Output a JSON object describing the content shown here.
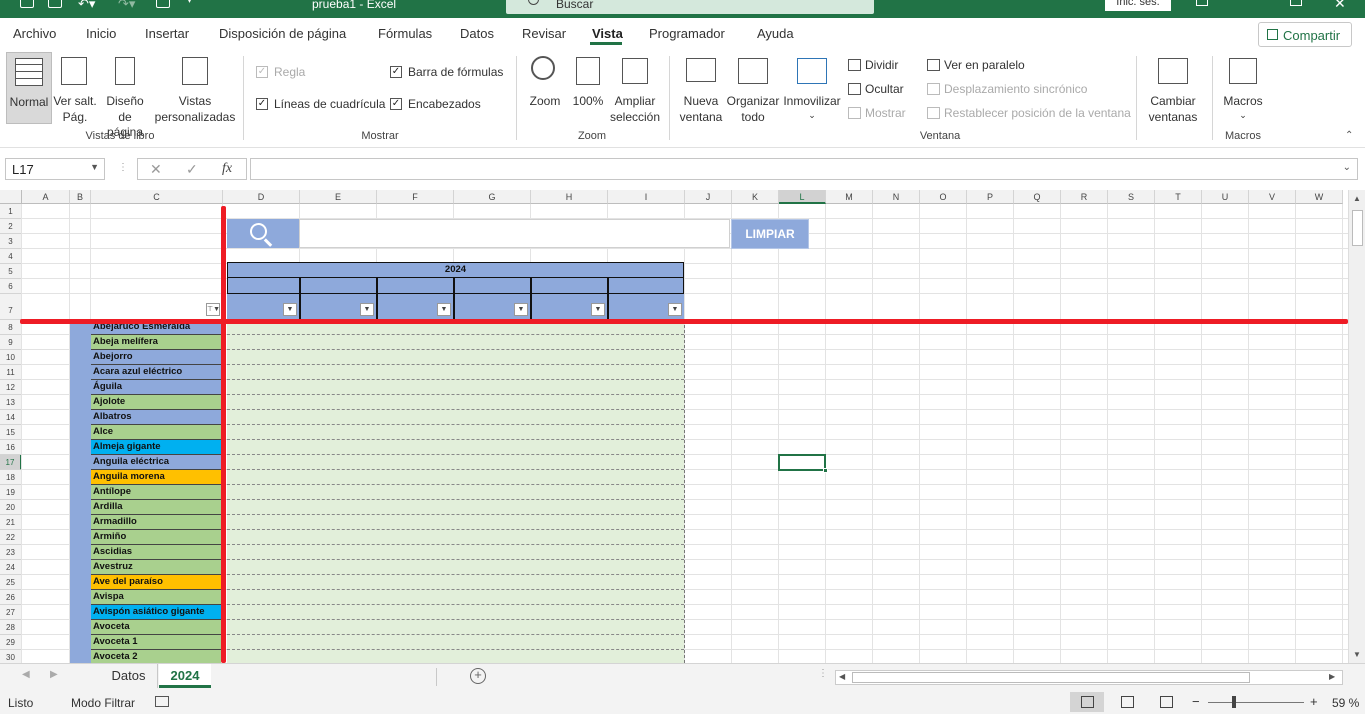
{
  "titlebar": {
    "doc_title": "prueba1  -  Excel",
    "search_placeholder": "Buscar",
    "signin": "Inic. ses."
  },
  "menu": {
    "tabs": [
      "Archivo",
      "Inicio",
      "Insertar",
      "Disposición de página",
      "Fórmulas",
      "Datos",
      "Revisar",
      "Vista",
      "Programador",
      "Ayuda"
    ],
    "active_tab": "Vista",
    "share": "Compartir"
  },
  "ribbon": {
    "vistas": {
      "normal": "Normal",
      "saltos_1": "Ver salt.",
      "saltos_2": "Pág.",
      "diseno_1": "Diseño",
      "diseno_2": "de página",
      "pers_1": "Vistas",
      "pers_2": "personalizadas",
      "group": "Vistas de libro"
    },
    "mostrar": {
      "regla": "Regla",
      "barra": "Barra de fórmulas",
      "lineas": "Líneas de cuadrícula",
      "encabezados": "Encabezados",
      "group": "Mostrar"
    },
    "zoom": {
      "zoom": "Zoom",
      "cien": "100%",
      "ampliar_1": "Ampliar",
      "ampliar_2": "selección",
      "group": "Zoom"
    },
    "ventana": {
      "nueva_1": "Nueva",
      "nueva_2": "ventana",
      "organizar_1": "Organizar",
      "organizar_2": "todo",
      "inmovilizar": "Inmovilizar",
      "dividir": "Dividir",
      "ocultar": "Ocultar",
      "mostrar": "Mostrar",
      "paralelo": "Ver en paralelo",
      "sincronico": "Desplazamiento sincrónico",
      "restablecer": "Restablecer posición de la ventana",
      "cambiar_1": "Cambiar",
      "cambiar_2": "ventanas",
      "group": "Ventana"
    },
    "macros": {
      "macros": "Macros",
      "group": "Macros"
    }
  },
  "formula_bar": {
    "name_box": "L17",
    "fx": "fx",
    "value": ""
  },
  "grid": {
    "columns": [
      "A",
      "B",
      "C",
      "D",
      "E",
      "F",
      "G",
      "H",
      "I",
      "J",
      "K",
      "L",
      "M",
      "N",
      "O",
      "P",
      "Q",
      "R",
      "S",
      "T",
      "U",
      "V",
      "W"
    ],
    "rows": [
      "1",
      "2",
      "3",
      "4",
      "5",
      "6",
      "7",
      "8",
      "9",
      "10",
      "11",
      "12",
      "13",
      "14",
      "15",
      "16",
      "17",
      "18",
      "19",
      "20",
      "21",
      "22",
      "23",
      "24",
      "25",
      "26",
      "27",
      "28",
      "29",
      "30"
    ],
    "year_header": "2024",
    "clear_button": "LIMPIAR",
    "animals": [
      {
        "name": "Abejaruco Esmeralda",
        "color": "#8ea9db"
      },
      {
        "name": "Abeja melífera",
        "color": "#a9d08e"
      },
      {
        "name": "Abejorro",
        "color": "#8ea9db"
      },
      {
        "name": "Acara azul eléctrico",
        "color": "#8ea9db"
      },
      {
        "name": "Águila",
        "color": "#8ea9db"
      },
      {
        "name": "Ajolote",
        "color": "#a9d08e"
      },
      {
        "name": "Albatros",
        "color": "#8ea9db"
      },
      {
        "name": "Alce",
        "color": "#a9d08e"
      },
      {
        "name": "Almeja gigante",
        "color": "#00b0f0"
      },
      {
        "name": "Anguila eléctrica",
        "color": "#8ea9db"
      },
      {
        "name": "Anguila morena",
        "color": "#ffc000"
      },
      {
        "name": "Antílope",
        "color": "#a9d08e"
      },
      {
        "name": "Ardilla",
        "color": "#a9d08e"
      },
      {
        "name": "Armadillo",
        "color": "#a9d08e"
      },
      {
        "name": "Armiño",
        "color": "#a9d08e"
      },
      {
        "name": "Ascidias",
        "color": "#a9d08e"
      },
      {
        "name": "Avestruz",
        "color": "#a9d08e"
      },
      {
        "name": "Ave del paraíso",
        "color": "#ffc000"
      },
      {
        "name": "Avispa",
        "color": "#a9d08e"
      },
      {
        "name": "Avispón asiático gigante",
        "color": "#00b0f0"
      },
      {
        "name": "Avoceta",
        "color": "#a9d08e"
      },
      {
        "name": "Avoceta 1",
        "color": "#a9d08e"
      },
      {
        "name": "Avoceta 2",
        "color": "#a9d08e"
      }
    ]
  },
  "sheets": {
    "tabs": [
      "Datos",
      "2024"
    ],
    "active": "2024"
  },
  "status": {
    "ready": "Listo",
    "mode": "Modo Filtrar",
    "zoom": "59 %"
  },
  "colors": {
    "excel_green": "#217346",
    "header_blue": "#8ea9db",
    "data_green": "#e2efda",
    "freeze_red": "#ee1c25"
  }
}
